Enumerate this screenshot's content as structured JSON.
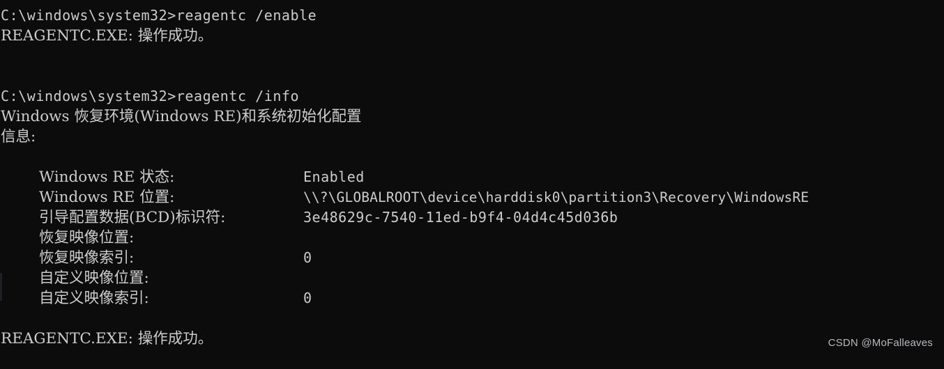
{
  "terminal": {
    "background_color": "#0c0c0c",
    "foreground_color": "#cccccc",
    "lines": [
      {
        "id": "cmd_enable",
        "text": "C:\\windows\\system32>reagentc /enable"
      },
      {
        "id": "result_enable",
        "text": "REAGENTC.EXE: 操作成功。"
      },
      {
        "id": "blank_1",
        "text": " "
      },
      {
        "id": "blank_2",
        "text": " "
      },
      {
        "id": "cmd_info",
        "text": "C:\\windows\\system32>reagentc /info"
      },
      {
        "id": "header_1",
        "text": "Windows 恢复环境(Windows RE)和系统初始化配置"
      },
      {
        "id": "header_2",
        "text": "信息:"
      },
      {
        "id": "blank_3",
        "text": " "
      }
    ],
    "details": [
      {
        "label": "Windows RE 状态:",
        "value": "Enabled"
      },
      {
        "label": "Windows RE 位置:",
        "value": "\\\\?\\GLOBALROOT\\device\\harddisk0\\partition3\\Recovery\\WindowsRE"
      },
      {
        "label": "引导配置数据(BCD)标识符:",
        "value": "3e48629c-7540-11ed-b9f4-04d4c45d036b"
      },
      {
        "label": "恢复映像位置:",
        "value": ""
      },
      {
        "label": "恢复映像索引:",
        "value": "0"
      },
      {
        "label": "自定义映像位置:",
        "value": ""
      },
      {
        "label": "自定义映像索引:",
        "value": "0"
      }
    ],
    "trailing": [
      {
        "id": "blank_4",
        "text": " "
      },
      {
        "id": "result_info",
        "text": "REAGENTC.EXE: 操作成功。"
      }
    ]
  },
  "watermark": {
    "text": "CSDN @MoFalleaves"
  }
}
